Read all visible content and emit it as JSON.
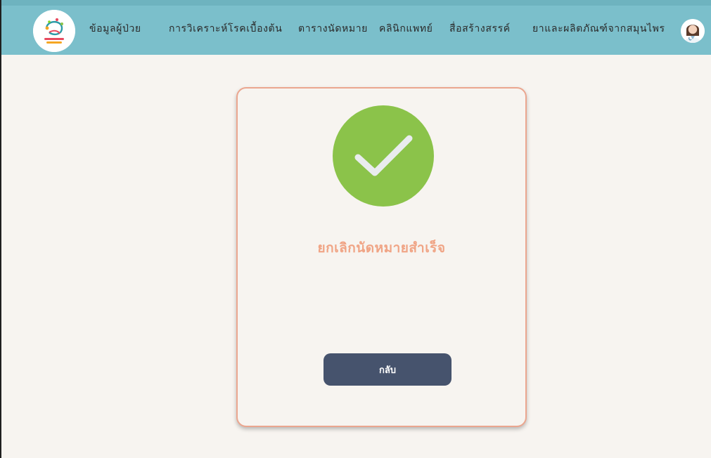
{
  "header": {
    "logo_icon": "app-logo-icon",
    "nav_items": [
      {
        "label": "ข้อมูลผู้ป่วย"
      },
      {
        "label": "การวิเคราะห์โรคเบื้องต้น"
      },
      {
        "label": "ตารางนัดหมาย"
      },
      {
        "label": "คลินิกแพทย์"
      },
      {
        "label": "สื่อสร้างสรรค์"
      },
      {
        "label": "ยาและผลิตภัณฑ์จากสมุนไพร"
      }
    ],
    "avatar_icon": "doctor-avatar-icon",
    "bar_color": "#7bbfcb"
  },
  "dialog": {
    "status_icon": "check-icon",
    "status_color": "#8bc34a",
    "message": "ยกเลิกนัดหมายสำเร็จ",
    "message_color": "#f0a485",
    "back_label": "กลับ",
    "button_color": "#46536d",
    "border_color": "#eba68f"
  }
}
